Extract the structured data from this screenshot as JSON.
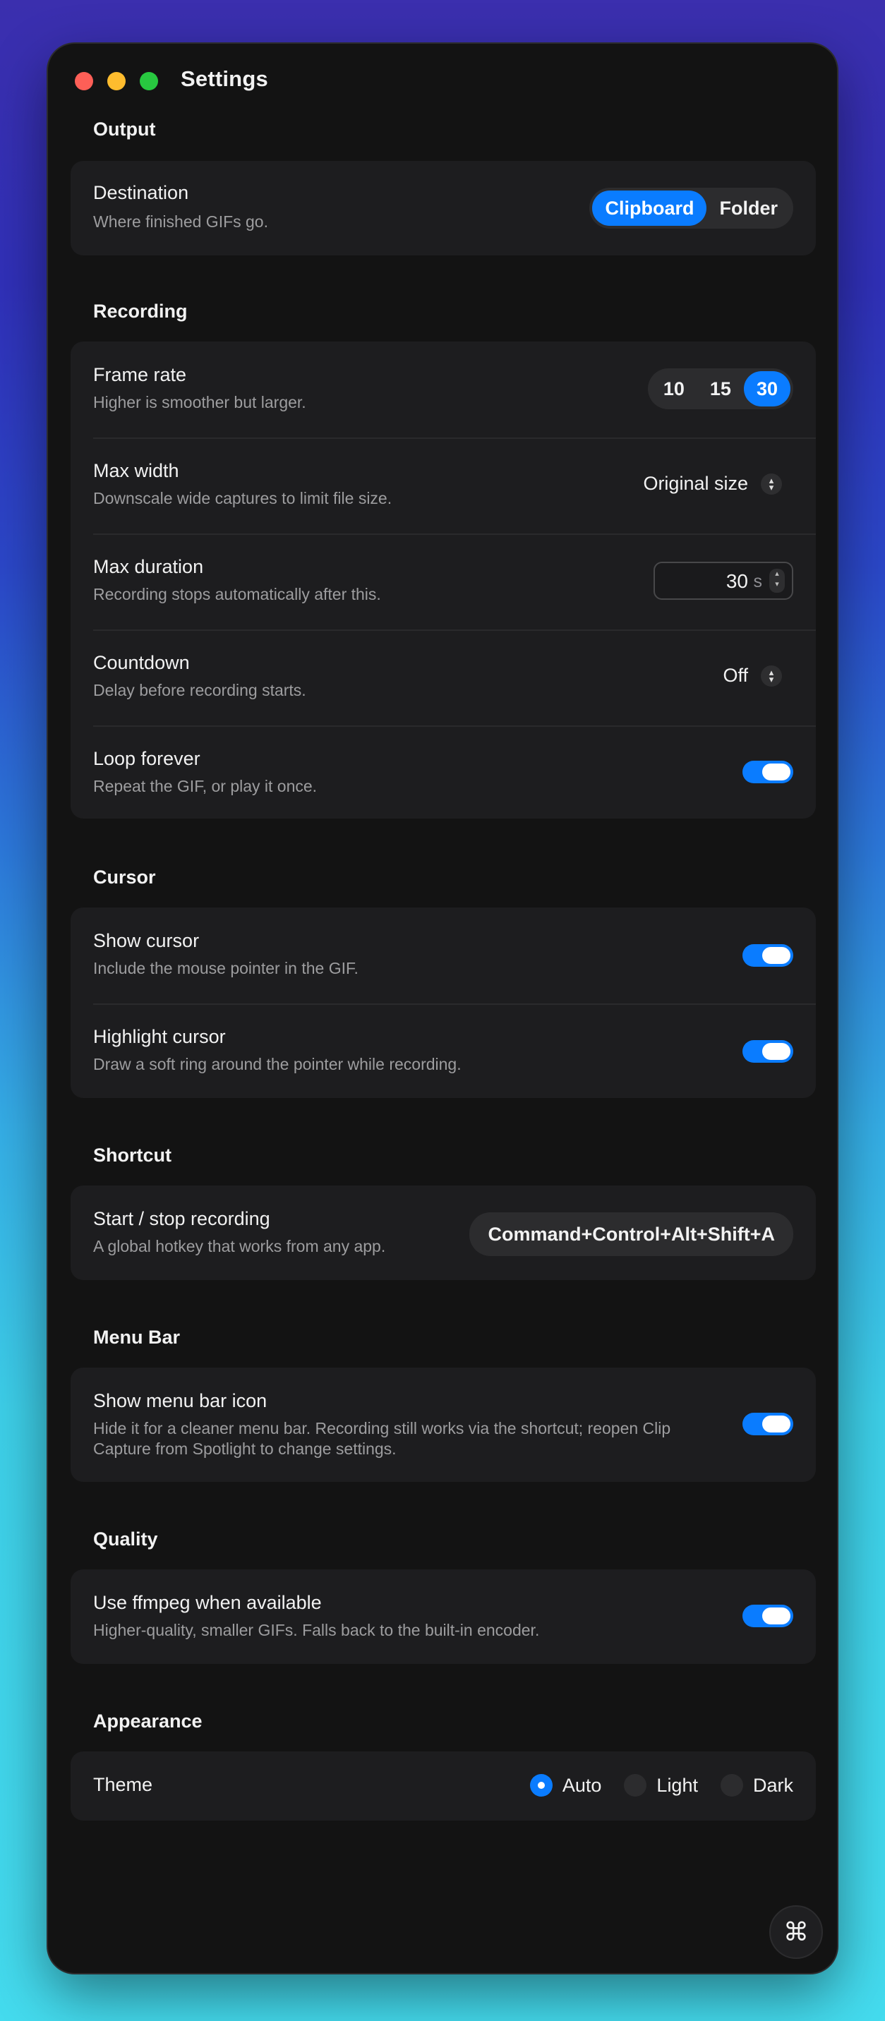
{
  "window": {
    "title": "Settings"
  },
  "sections": {
    "output": {
      "title": "Output",
      "destination": {
        "label": "Destination",
        "desc": "Where finished GIFs go.",
        "options": [
          "Clipboard",
          "Folder"
        ],
        "selected": "Clipboard"
      }
    },
    "recording": {
      "title": "Recording",
      "frame_rate": {
        "label": "Frame rate",
        "desc": "Higher is smoother but larger.",
        "options": [
          "10",
          "15",
          "30"
        ],
        "selected": "30"
      },
      "max_width": {
        "label": "Max width",
        "desc": "Downscale wide captures to limit file size.",
        "value": "Original size"
      },
      "max_duration": {
        "label": "Max duration",
        "desc": "Recording stops automatically after this.",
        "value": "30",
        "unit": "s"
      },
      "countdown": {
        "label": "Countdown",
        "desc": "Delay before recording starts.",
        "value": "Off"
      },
      "loop": {
        "label": "Loop forever",
        "desc": "Repeat the GIF, or play it once.",
        "on": true
      }
    },
    "cursor": {
      "title": "Cursor",
      "show": {
        "label": "Show cursor",
        "desc": "Include the mouse pointer in the GIF.",
        "on": true
      },
      "highlight": {
        "label": "Highlight cursor",
        "desc": "Draw a soft ring around the pointer while recording.",
        "on": true
      }
    },
    "shortcut": {
      "title": "Shortcut",
      "start_stop": {
        "label": "Start / stop recording",
        "desc": "A global hotkey that works from any app.",
        "value": "Command+Control+Alt+Shift+A"
      }
    },
    "menubar": {
      "title": "Menu Bar",
      "show_icon": {
        "label": "Show menu bar icon",
        "desc": "Hide it for a cleaner menu bar. Recording still works via the shortcut; reopen Clip Capture from Spotlight to change settings.",
        "on": true
      }
    },
    "quality": {
      "title": "Quality",
      "ffmpeg": {
        "label": "Use ffmpeg when available",
        "desc": "Higher-quality, smaller GIFs. Falls back to the built-in encoder.",
        "on": true
      }
    },
    "appearance": {
      "title": "Appearance",
      "theme": {
        "label": "Theme",
        "options": [
          "Auto",
          "Light",
          "Dark"
        ],
        "selected": "Auto"
      }
    }
  },
  "colors": {
    "accent": "#0a7cff",
    "window_bg": "#131313",
    "card_bg": "#1d1d1f"
  },
  "icons": {
    "fab": "command-icon"
  }
}
